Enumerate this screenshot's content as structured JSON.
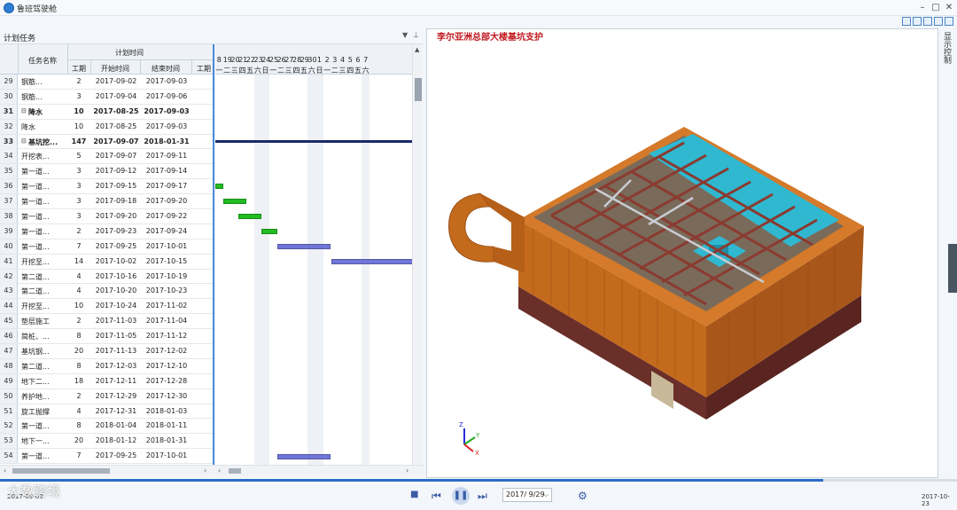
{
  "app": {
    "title": "鲁班驾驶舱"
  },
  "panel": {
    "title": "计划任务"
  },
  "grid": {
    "headers": {
      "name": "任务名称",
      "plan": "计划时间",
      "duration": "工期",
      "start": "开始时间",
      "end": "结束时间",
      "gantt_duration": "工期"
    },
    "rows": [
      {
        "id": "29",
        "name": "钢筋...",
        "duration": "2",
        "start": "2017-09-02",
        "end": "2017-09-03"
      },
      {
        "id": "30",
        "name": "钢筋...",
        "duration": "3",
        "start": "2017-09-04",
        "end": "2017-09-06"
      },
      {
        "id": "31",
        "name": "降水",
        "duration": "10",
        "start": "2017-08-25",
        "end": "2017-09-03",
        "bold": true,
        "collapse": "⊟"
      },
      {
        "id": "32",
        "name": "降水",
        "duration": "10",
        "start": "2017-08-25",
        "end": "2017-09-03"
      },
      {
        "id": "33",
        "name": "基坑挖...",
        "duration": "147",
        "start": "2017-09-07",
        "end": "2018-01-31",
        "bold": true,
        "collapse": "⊟"
      },
      {
        "id": "34",
        "name": "开挖表...",
        "duration": "5",
        "start": "2017-09-07",
        "end": "2017-09-11"
      },
      {
        "id": "35",
        "name": "第一道...",
        "duration": "3",
        "start": "2017-09-12",
        "end": "2017-09-14"
      },
      {
        "id": "36",
        "name": "第一道...",
        "duration": "3",
        "start": "2017-09-15",
        "end": "2017-09-17"
      },
      {
        "id": "37",
        "name": "第一道...",
        "duration": "3",
        "start": "2017-09-18",
        "end": "2017-09-20"
      },
      {
        "id": "38",
        "name": "第一道...",
        "duration": "3",
        "start": "2017-09-20",
        "end": "2017-09-22"
      },
      {
        "id": "39",
        "name": "第一道...",
        "duration": "2",
        "start": "2017-09-23",
        "end": "2017-09-24"
      },
      {
        "id": "40",
        "name": "第一道...",
        "duration": "7",
        "start": "2017-09-25",
        "end": "2017-10-01"
      },
      {
        "id": "41",
        "name": "开挖至...",
        "duration": "14",
        "start": "2017-10-02",
        "end": "2017-10-15"
      },
      {
        "id": "42",
        "name": "第二道...",
        "duration": "4",
        "start": "2017-10-16",
        "end": "2017-10-19"
      },
      {
        "id": "43",
        "name": "第二道...",
        "duration": "4",
        "start": "2017-10-20",
        "end": "2017-10-23"
      },
      {
        "id": "44",
        "name": "开挖至...",
        "duration": "10",
        "start": "2017-10-24",
        "end": "2017-11-02"
      },
      {
        "id": "45",
        "name": "垫层施工",
        "duration": "2",
        "start": "2017-11-03",
        "end": "2017-11-04"
      },
      {
        "id": "46",
        "name": "简桩、...",
        "duration": "8",
        "start": "2017-11-05",
        "end": "2017-11-12"
      },
      {
        "id": "47",
        "name": "基坑钢...",
        "duration": "20",
        "start": "2017-11-13",
        "end": "2017-12-02"
      },
      {
        "id": "48",
        "name": "第二道...",
        "duration": "8",
        "start": "2017-12-03",
        "end": "2017-12-10"
      },
      {
        "id": "49",
        "name": "地下二...",
        "duration": "18",
        "start": "2017-12-11",
        "end": "2017-12-28"
      },
      {
        "id": "50",
        "name": "养护地...",
        "duration": "2",
        "start": "2017-12-29",
        "end": "2017-12-30"
      },
      {
        "id": "51",
        "name": "旋工抛撑",
        "duration": "4",
        "start": "2017-12-31",
        "end": "2018-01-03"
      },
      {
        "id": "52",
        "name": "第一道...",
        "duration": "8",
        "start": "2018-01-04",
        "end": "2018-01-11"
      },
      {
        "id": "53",
        "name": "地下一...",
        "duration": "20",
        "start": "2018-01-12",
        "end": "2018-01-31"
      },
      {
        "id": "54",
        "name": "第一道...",
        "duration": "7",
        "start": "2017-09-25",
        "end": "2017-10-01"
      }
    ]
  },
  "gantt": {
    "days": [
      "8",
      "19",
      "20",
      "21",
      "22",
      "23",
      "24",
      "25",
      "26",
      "27",
      "28",
      "29",
      "30",
      "1",
      "2",
      "3",
      "4",
      "5",
      "6",
      "7"
    ],
    "weekdays": [
      "一",
      "二",
      "三",
      "四",
      "五",
      "六",
      "日",
      "一",
      "二",
      "三",
      "四",
      "五",
      "六",
      "日",
      "一",
      "二",
      "三",
      "四",
      "五",
      "六"
    ],
    "bar_colors": {
      "green": "#22bb22",
      "blue": "#7076d8",
      "summary": "#1a2a6b"
    }
  },
  "view": {
    "title": "李尔亚洲总部大楼基坑支护",
    "side_tab": "显示控制"
  },
  "playback": {
    "date_value": "2017/ 9/29",
    "start_date": "2017-09-03",
    "end_date": "2017-10-23",
    "progress": 0.86
  },
  "watermark": "大数跨境",
  "colors": {
    "accent": "#2b6cc4",
    "title_red": "#c0181d",
    "wall_orange": "#c46a1c",
    "water_cyan": "#2fb8d0"
  }
}
